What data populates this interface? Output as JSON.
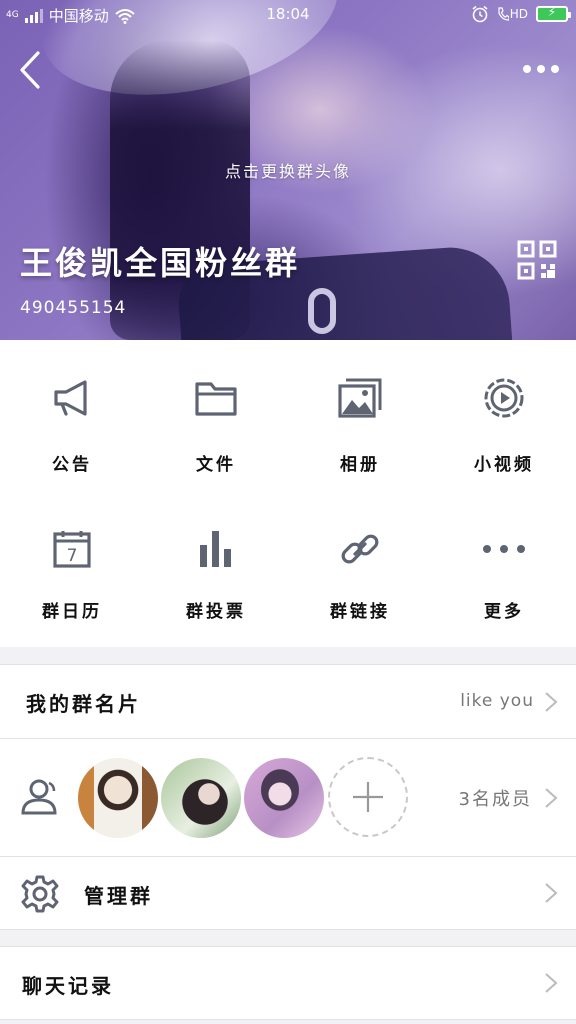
{
  "status_bar": {
    "network": "4G",
    "carrier": "中国移动",
    "time": "18:04",
    "hd": "HD",
    "battery_symbol": "⚡"
  },
  "header": {
    "avatar_hint": "点击更换群头像",
    "group_name": "王俊凯全国粉丝群",
    "group_id": "490455154"
  },
  "features": [
    {
      "label": "公告",
      "icon": "megaphone-icon"
    },
    {
      "label": "文件",
      "icon": "folder-icon"
    },
    {
      "label": "相册",
      "icon": "album-icon"
    },
    {
      "label": "小视频",
      "icon": "video-icon"
    },
    {
      "label": "群日历",
      "icon": "calendar-icon",
      "day": "7"
    },
    {
      "label": "群投票",
      "icon": "bar-chart-icon"
    },
    {
      "label": "群链接",
      "icon": "link-icon"
    },
    {
      "label": "更多",
      "icon": "more-dots-icon"
    }
  ],
  "my_card": {
    "label": "我的群名片",
    "value": "like you"
  },
  "members": {
    "count_label": "3名成员"
  },
  "manage": {
    "label": "管理群"
  },
  "history": {
    "label": "聊天记录"
  },
  "colors": {
    "icon_gray": "#5f6473",
    "header_purple": "#8a74c0",
    "divider": "#e1e1e5"
  }
}
